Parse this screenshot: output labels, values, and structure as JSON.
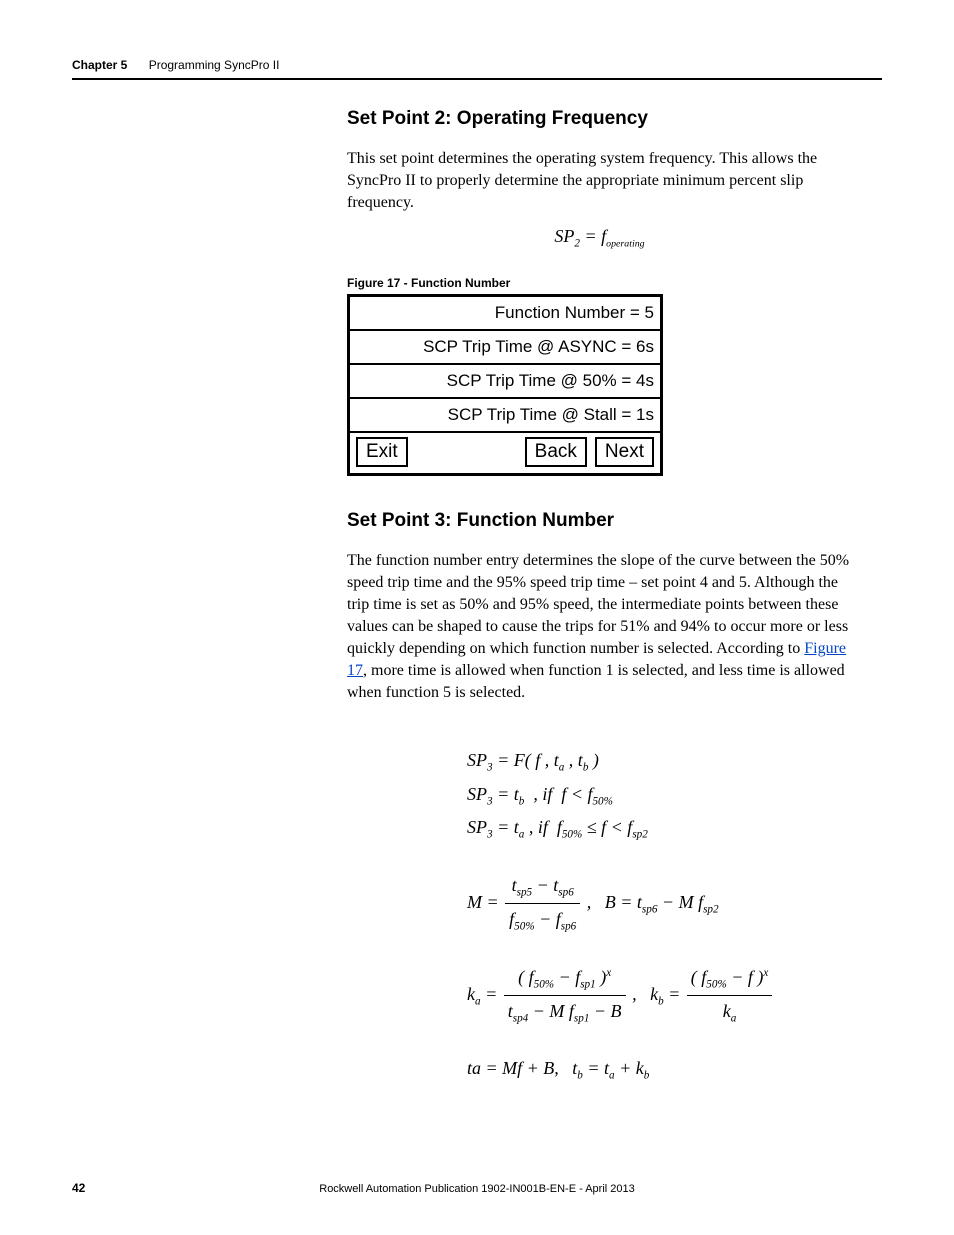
{
  "header": {
    "chapter_label": "Chapter 5",
    "chapter_title": "Programming SyncPro II"
  },
  "section_sp2": {
    "heading": "Set Point 2: Operating Frequency",
    "body": "This set point determines the operating system frequency. This allows the SyncPro II to properly determine the appropriate minimum percent slip frequency.",
    "equation": "SP₂ = f_operating"
  },
  "figure17": {
    "caption": "Figure 17 - Function Number",
    "rows": [
      "Function Number = 5",
      "SCP Trip Time @ ASYNC = 6s",
      "SCP Trip Time @ 50% = 4s",
      "SCP Trip Time @ Stall = 1s"
    ],
    "buttons": {
      "exit": "Exit",
      "back": "Back",
      "next": "Next"
    }
  },
  "section_sp3": {
    "heading": "Set Point 3: Function Number",
    "body_pre": "The function number entry determines the slope of the curve between the 50% speed trip time and the 95% speed trip time – set point 4 and 5. Although the trip time is set as 50% and 95% speed, the intermediate points between these values can be shaped to cause the trips for 51% and 94% to occur more or less quickly depending on which function number is selected. According to ",
    "link_text": "Figure 17",
    "body_post": ", more time is allowed when function 1 is selected, and less time is allowed when function 5 is selected."
  },
  "equations_sp3": {
    "line1": "SP₃ = F(f, tₐ, t_b)",
    "line2": "SP₃ = t_b , if f < f₅₀%",
    "line3": "SP₃ = tₐ , if f₅₀% ≤ f < f_sp2",
    "M_label": "M =",
    "M_num": "t_sp5 − t_sp6",
    "M_den": "f₅₀% − f_sp6",
    "B_eq": "B = t_sp6 − M f_sp2",
    "ka_label": "kₐ =",
    "ka_num": "(f₅₀% − f_sp1)ˣ",
    "ka_den": "t_sp4 − M f_sp1 − B",
    "kb_label": "k_b =",
    "kb_num": "(f₅₀% − f)ˣ",
    "kb_den": "kₐ",
    "last_line": "ta = Mf + B,   t_b = tₐ + k_b"
  },
  "footer": {
    "page_number": "42",
    "publication": "Rockwell Automation Publication 1902-IN001B-EN-E - April 2013"
  }
}
